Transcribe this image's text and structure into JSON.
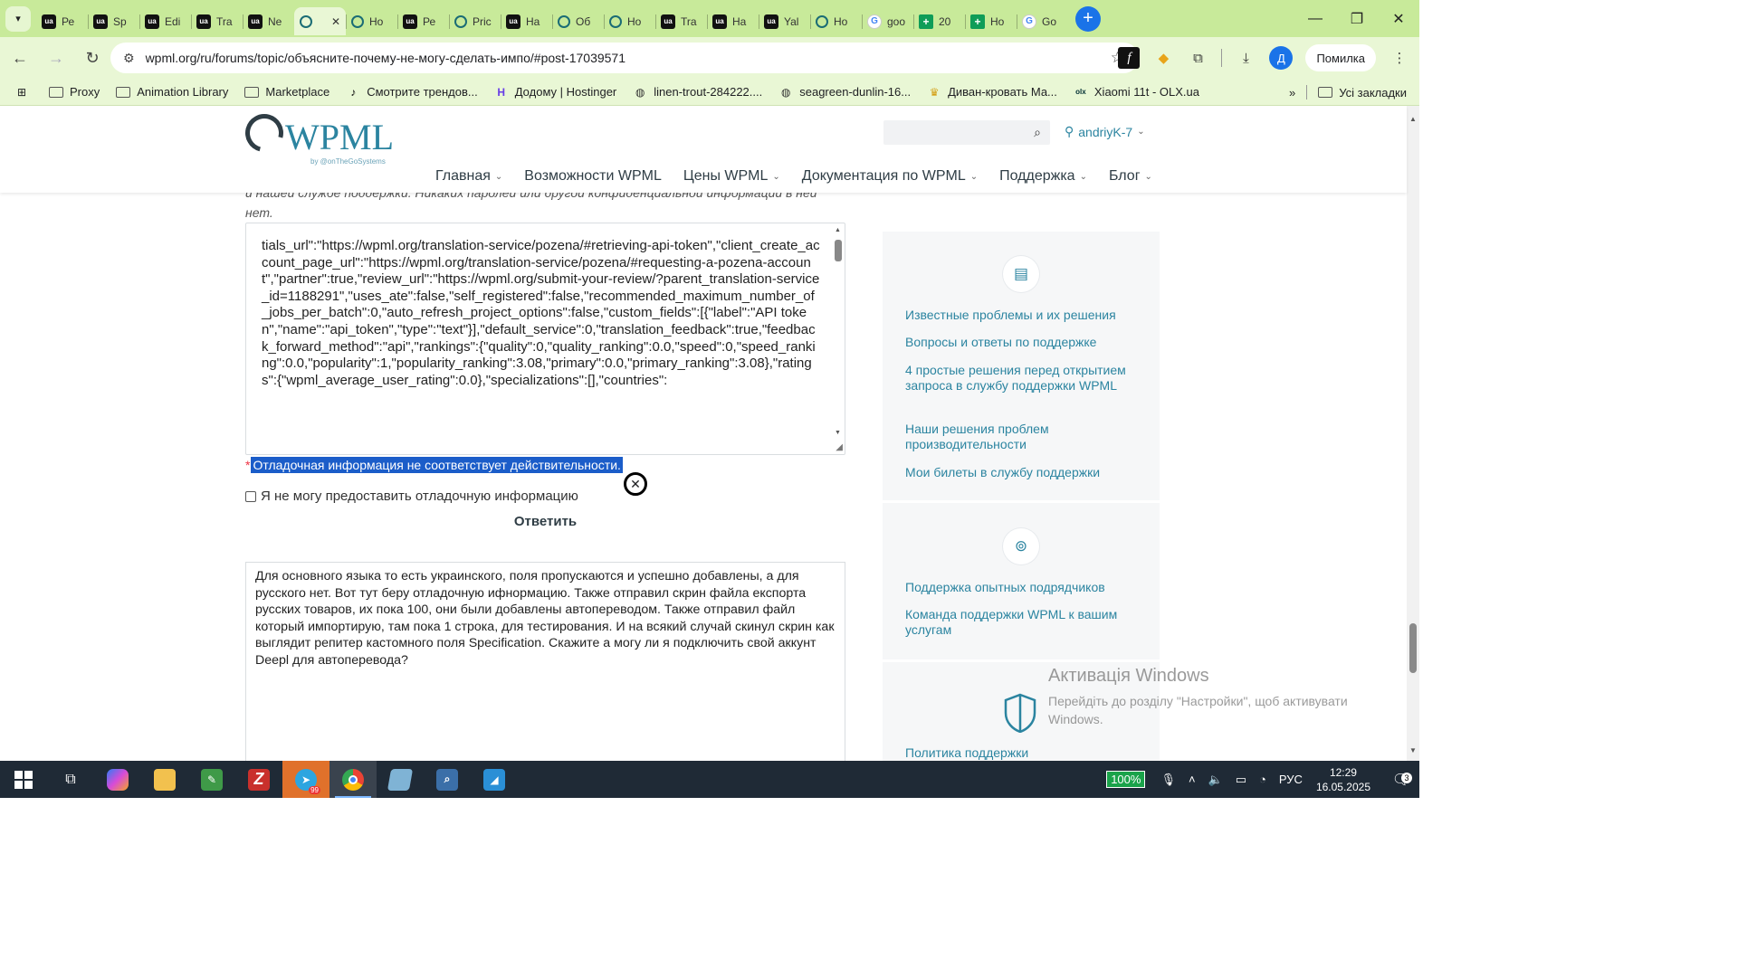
{
  "browser": {
    "tabs": [
      {
        "icon": "ua",
        "label": "Ре"
      },
      {
        "icon": "ua",
        "label": "Sp"
      },
      {
        "icon": "ua",
        "label": "Edi"
      },
      {
        "icon": "ua",
        "label": "Tra"
      },
      {
        "icon": "ua",
        "label": "Ne"
      },
      {
        "icon": "wp",
        "label": "",
        "active": true
      },
      {
        "icon": "wp",
        "label": "Но"
      },
      {
        "icon": "ua",
        "label": "Ре"
      },
      {
        "icon": "wp",
        "label": "Pric"
      },
      {
        "icon": "ua",
        "label": "На"
      },
      {
        "icon": "wp",
        "label": "Об"
      },
      {
        "icon": "wp",
        "label": "Но"
      },
      {
        "icon": "ua",
        "label": "Tra"
      },
      {
        "icon": "ua",
        "label": "На"
      },
      {
        "icon": "ua",
        "label": "Yal"
      },
      {
        "icon": "wp",
        "label": "Но"
      },
      {
        "icon": "g",
        "label": "goo"
      },
      {
        "icon": "sheet",
        "label": "20"
      },
      {
        "icon": "sheet",
        "label": "Но"
      },
      {
        "icon": "g",
        "label": "Go"
      }
    ],
    "url": "wpml.org/ru/forums/topic/объясните-почему-не-могу-сделать-импо/#post-17039571",
    "error_button": "Помилка",
    "avatar_letter": "Д",
    "bookmarks": [
      {
        "icon": "folder",
        "label": "Proxy"
      },
      {
        "icon": "folder",
        "label": "Animation Library"
      },
      {
        "icon": "folder",
        "label": "Marketplace"
      },
      {
        "icon": "tiktok",
        "label": "Смотрите трендов..."
      },
      {
        "icon": "hostinger",
        "label": "Додому | Hostinger"
      },
      {
        "icon": "globe",
        "label": "linen-trout-284222...."
      },
      {
        "icon": "globe",
        "label": "seagreen-dunlin-16..."
      },
      {
        "icon": "sofa",
        "label": "Диван-кровать Ма..."
      },
      {
        "icon": "olx",
        "label": "Xiaomi 11t - OLX.ua"
      }
    ],
    "all_bookmarks": "Усі закладки"
  },
  "site": {
    "logo_text": "WPML",
    "logo_by": "by @onTheGoSystems",
    "user": "andriyK-7",
    "nav": [
      "Главная",
      "Возможности WPML",
      "Цены WPML",
      "Документация по WPML",
      "Поддержка",
      "Блог"
    ],
    "nav_has_dropdown": [
      true,
      false,
      true,
      true,
      true,
      true
    ]
  },
  "form": {
    "intro_text": "и нашей службе поддержки. Никаких паролей или другой конфиденциальной информации в ней нет.",
    "debug_text": "tials_url\":\"https://wpml.org/translation-service/pozena/#retrieving-api-token\",\"client_create_account_page_url\":\"https://wpml.org/translation-service/pozena/#requesting-a-pozena-account\",\"partner\":true,\"review_url\":\"https://wpml.org/submit-your-review/?parent_translation-service_id=1188291\",\"uses_ate\":false,\"self_registered\":false,\"recommended_maximum_number_of_jobs_per_batch\":0,\"auto_refresh_project_options\":false,\"custom_fields\":[{\"label\":\"API token\",\"name\":\"api_token\",\"type\":\"text\"}],\"default_service\":0,\"translation_feedback\":true,\"feedback_forward_method\":\"api\",\"rankings\":{\"quality\":0,\"quality_ranking\":0.0,\"speed\":0,\"speed_ranking\":0.0,\"popularity\":1,\"popularity_ranking\":3.08,\"primary\":0.0,\"primary_ranking\":3.08},\"ratings\":{\"wpml_average_user_rating\":0.0},\"specializations\":[],\"countries\":",
    "error_required": "*",
    "error_message": "Отладочная информация не соответствует действительности.",
    "cannot_provide_label": "Я не могу предоставить отладочную информацию",
    "reply_heading": "Ответить",
    "reply_text": "Для основного языка то есть украинского, поля пропускаются и успешно добавлены, а для русского нет. Вот тут беру отладочную ифнормацию. Также отправил скрин файла експорта русских товаров, их пока 100, они были добавлены автопереводом. Также отправил файл который импортирую, там пока 1 строка, для тестирования. И на всякий случай скинул скрин как выглядит репитер кастомного поля Specification. Скажите а могу ли я подключить свой аккунт Deepl для автоперевода?"
  },
  "sidebar": {
    "section1_links": [
      "Известные проблемы и их решения",
      "Вопросы и ответы по поддержке",
      "4 простые решения перед открытием запроса в службу поддержки WPML",
      "Наши решения проблем производительности",
      "Мои билеты в службу поддержки"
    ],
    "section2_links": [
      "Поддержка опытных подрядчиков",
      "Команда поддержки WPML к вашим услугам"
    ],
    "section3_link": "Политика поддержки"
  },
  "watermark": {
    "title": "Активація Windows",
    "text": "Перейдіть до розділу \"Настройки\", щоб активувати Windows."
  },
  "taskbar": {
    "apps": [
      "start",
      "task-view",
      "copilot",
      "file-explorer",
      "notepad-app",
      "filezilla",
      "telegram",
      "chrome",
      "app-blue",
      "search-app",
      "paint-app"
    ],
    "telegram_badge": "99",
    "battery": "100%",
    "language": "РУС",
    "time": "12:29",
    "date": "16.05.2025",
    "notification_count": "3"
  },
  "colors": {
    "tabstrip": "#c8ea9a",
    "toolbar": "#e9f7d5",
    "wpml_blue": "#2b84a0",
    "selection": "#1b5dc9",
    "taskbar": "#1f2a36"
  }
}
